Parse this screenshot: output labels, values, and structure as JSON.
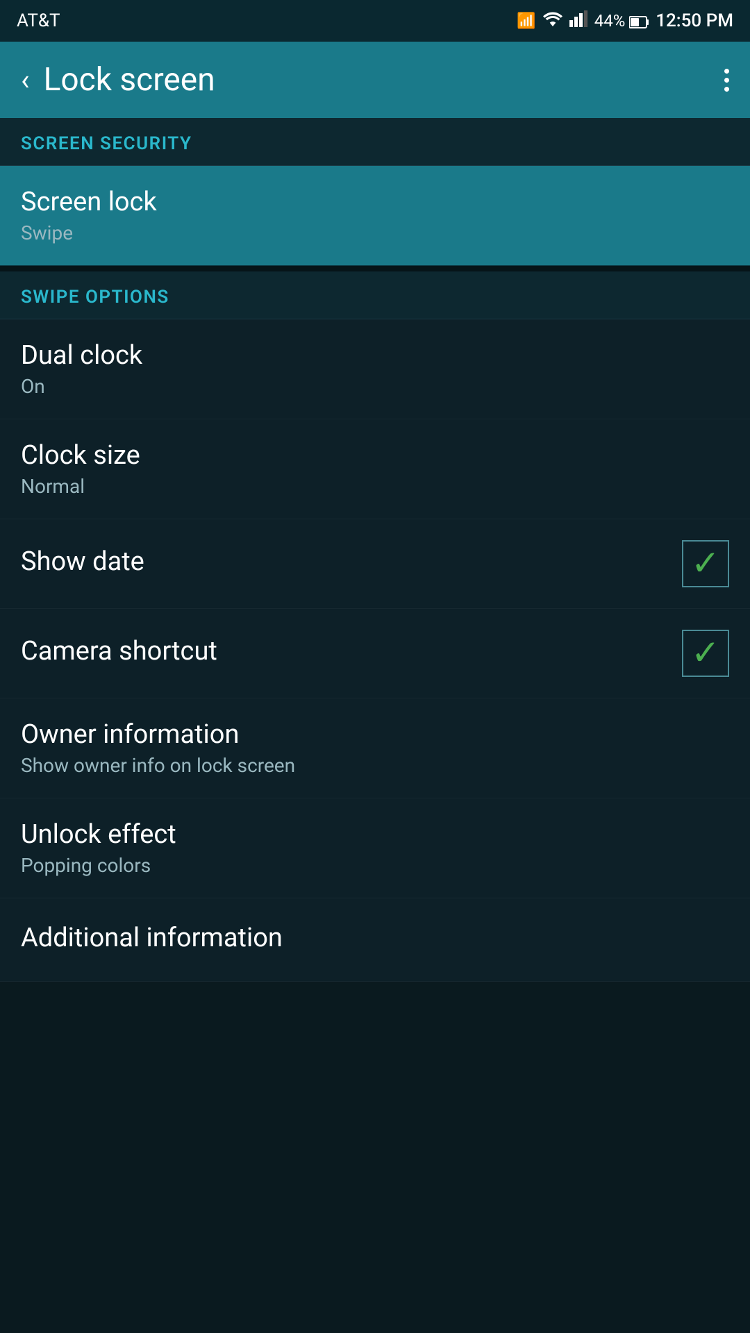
{
  "status_bar": {
    "carrier": "AT&T",
    "battery": "44%",
    "time": "12:50 PM"
  },
  "app_bar": {
    "title": "Lock screen",
    "more_label": "More options"
  },
  "sections": [
    {
      "id": "screen_security",
      "header": "SCREEN SECURITY",
      "items": [
        {
          "id": "screen_lock",
          "title": "Screen lock",
          "subtitle": "Swipe",
          "highlighted": true,
          "has_checkbox": false
        }
      ]
    },
    {
      "id": "swipe_options",
      "header": "SWIPE OPTIONS",
      "items": [
        {
          "id": "dual_clock",
          "title": "Dual clock",
          "subtitle": "On",
          "highlighted": false,
          "has_checkbox": false
        },
        {
          "id": "clock_size",
          "title": "Clock size",
          "subtitle": "Normal",
          "highlighted": false,
          "has_checkbox": false
        },
        {
          "id": "show_date",
          "title": "Show date",
          "subtitle": "",
          "highlighted": false,
          "has_checkbox": true,
          "checked": true
        },
        {
          "id": "camera_shortcut",
          "title": "Camera shortcut",
          "subtitle": "",
          "highlighted": false,
          "has_checkbox": true,
          "checked": true
        },
        {
          "id": "owner_information",
          "title": "Owner information",
          "subtitle": "Show owner info on lock screen",
          "highlighted": false,
          "has_checkbox": false
        },
        {
          "id": "unlock_effect",
          "title": "Unlock effect",
          "subtitle": "Popping colors",
          "highlighted": false,
          "has_checkbox": false
        },
        {
          "id": "additional_information",
          "title": "Additional information",
          "subtitle": "",
          "highlighted": false,
          "has_checkbox": false
        }
      ]
    }
  ]
}
